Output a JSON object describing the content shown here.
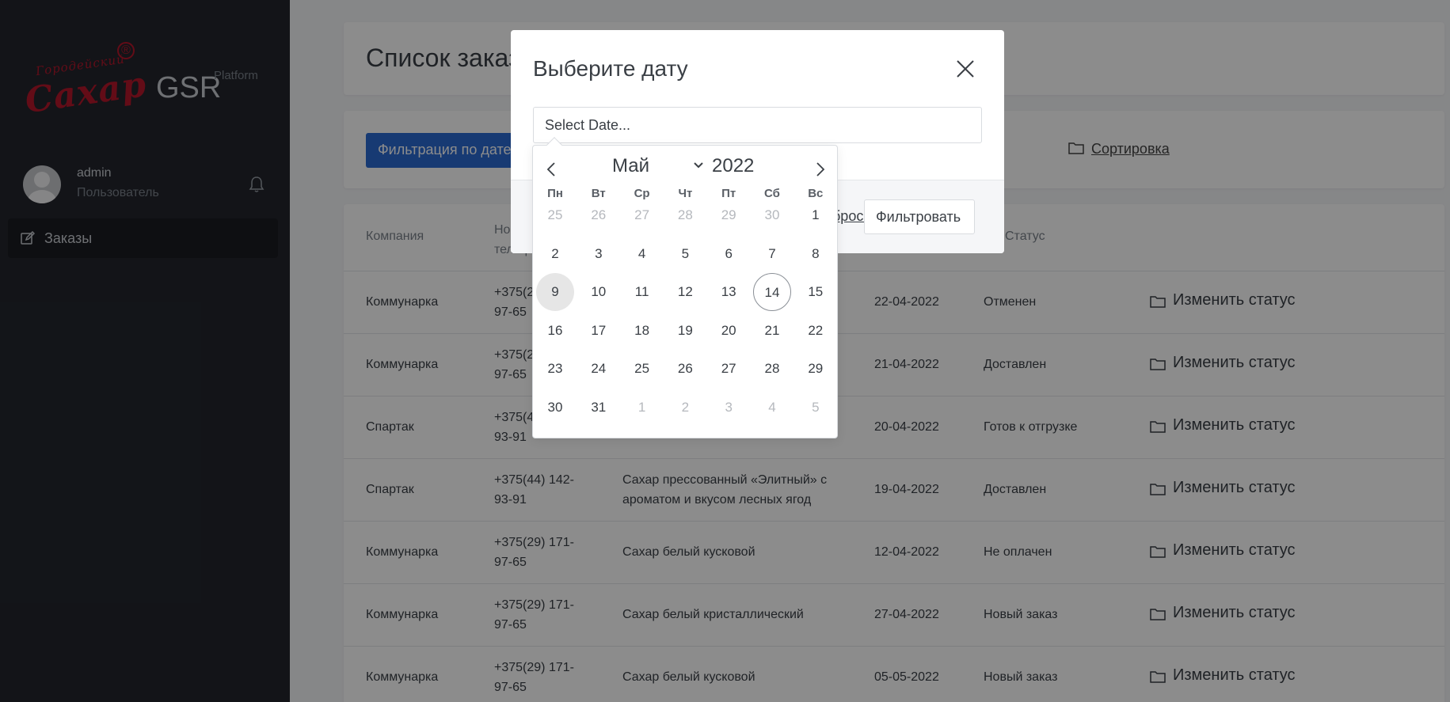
{
  "brand": {
    "logo_line1": "Городейский",
    "logo_line2": "Сахар",
    "logo_mark": "®",
    "name": "GSR",
    "subtitle": "Platform"
  },
  "user": {
    "name": "admin",
    "role": "Пользователь",
    "avatar_icon": "user-avatar-icon",
    "notification_icon": "bell-icon"
  },
  "nav": {
    "items": [
      {
        "label": "Заказы",
        "icon": "edit-icon"
      }
    ]
  },
  "page": {
    "title": "Список заказов"
  },
  "filters": {
    "date_button": "Фильтрация по дате",
    "sort_label": "Сортировка",
    "sort_icon": "folder-icon"
  },
  "table": {
    "headers": [
      "Компания",
      "Номер телефона",
      "Статус"
    ],
    "action_label": "Изменить статус",
    "rows": [
      {
        "company": "Коммунарка",
        "phone": "+375(29) 171-97-65",
        "product": "",
        "date": "22-04-2022",
        "status": "Отменен"
      },
      {
        "company": "Коммунарка",
        "phone": "+375(29) 171-97-65",
        "product": "",
        "date": "21-04-2022",
        "status": "Доставлен"
      },
      {
        "company": "Спартак",
        "phone": "+375(44) 142-93-91",
        "product": "",
        "date": "20-04-2022",
        "status": "Готов к отгрузке"
      },
      {
        "company": "Спартак",
        "phone": "+375(44) 142-93-91",
        "product": "Сахар прессованный «Элитный» с ароматом и вкусом лесных ягод",
        "date": "19-04-2022",
        "status": "Доставлен"
      },
      {
        "company": "Коммунарка",
        "phone": "+375(29) 171-97-65",
        "product": "Сахар белый кусковой",
        "date": "12-04-2022",
        "status": "Не оплачен"
      },
      {
        "company": "Коммунарка",
        "phone": "+375(29) 171-97-65",
        "product": "Сахар белый кристаллический",
        "date": "27-04-2022",
        "status": "Новый заказ"
      },
      {
        "company": "Коммунарка",
        "phone": "+375(29) 171-97-65",
        "product": "Сахар белый кусковой",
        "date": "05-05-2022",
        "status": "Новый заказ"
      }
    ]
  },
  "modal": {
    "title": "Выберите дату",
    "close_icon": "close-icon",
    "input_value": "Select Date...",
    "reset_label": "Сбросить",
    "filter_button": "Фильтровать"
  },
  "calendar": {
    "month": "Май",
    "year": "2022",
    "weekdays": [
      "Пн",
      "Вт",
      "Ср",
      "Чт",
      "Пт",
      "Сб",
      "Вс"
    ],
    "weeks": [
      [
        "25",
        "26",
        "27",
        "28",
        "29",
        "30",
        "1"
      ],
      [
        "2",
        "3",
        "4",
        "5",
        "6",
        "7",
        "8"
      ],
      [
        "9",
        "10",
        "11",
        "12",
        "13",
        "14",
        "15"
      ],
      [
        "16",
        "17",
        "18",
        "19",
        "20",
        "21",
        "22"
      ],
      [
        "23",
        "24",
        "25",
        "26",
        "27",
        "28",
        "29"
      ],
      [
        "30",
        "31",
        "1",
        "2",
        "3",
        "4",
        "5"
      ]
    ],
    "muted": [
      [
        0,
        0
      ],
      [
        0,
        1
      ],
      [
        0,
        2
      ],
      [
        0,
        3
      ],
      [
        0,
        4
      ],
      [
        0,
        5
      ],
      [
        5,
        2
      ],
      [
        5,
        3
      ],
      [
        5,
        4
      ],
      [
        5,
        5
      ],
      [
        5,
        6
      ]
    ],
    "hover": [
      2,
      0
    ],
    "today": [
      2,
      5
    ]
  },
  "colors": {
    "sidebar": "#23262d",
    "accent": "#2a6bd1",
    "logo": "#b4172b"
  }
}
